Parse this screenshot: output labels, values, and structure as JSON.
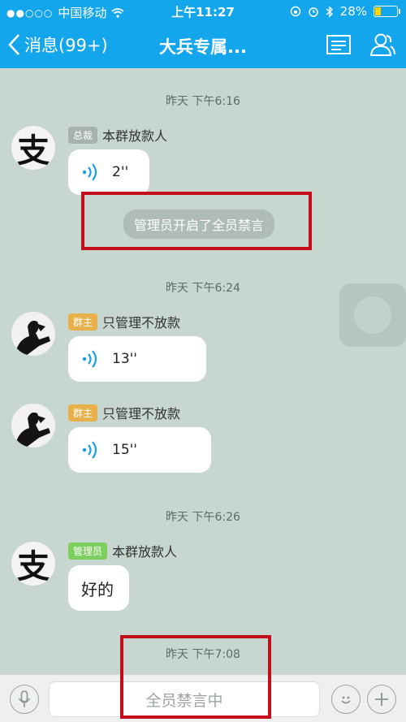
{
  "status": {
    "signal": "●●○○○",
    "carrier": "中国移动",
    "time": "上午11:27",
    "battery": "28%",
    "battery_level": 0.28
  },
  "nav": {
    "back_label": "消息(99+)",
    "title": "大兵专属..."
  },
  "messages": [
    {
      "timestamp": "昨天 下午6:16",
      "sender": "本群放款人",
      "badge": "总裁",
      "badge_color": "#a7b2ae",
      "duration": "2''"
    },
    {
      "system": "管理员开启了全员禁言"
    },
    {
      "timestamp": "昨天 下午6:24",
      "sender": "只管理不放款",
      "badge": "群主",
      "badge_color": "#e7b04b",
      "duration": "13''"
    },
    {
      "sender": "只管理不放款",
      "badge": "群主",
      "badge_color": "#e7b04b",
      "duration": "15''"
    },
    {
      "timestamp": "昨天 下午6:26",
      "sender": "本群放款人",
      "badge": "管理员",
      "badge_color": "#7dcf5e",
      "text": "好的"
    },
    {
      "timestamp": "昨天 下午7:08"
    }
  ],
  "avatar_char": "支",
  "input": {
    "placeholder": "全员禁言中"
  },
  "colors": {
    "header": "#13a6ec",
    "chat_bg": "#c7d6cf",
    "highlight": "#c40d1a"
  }
}
